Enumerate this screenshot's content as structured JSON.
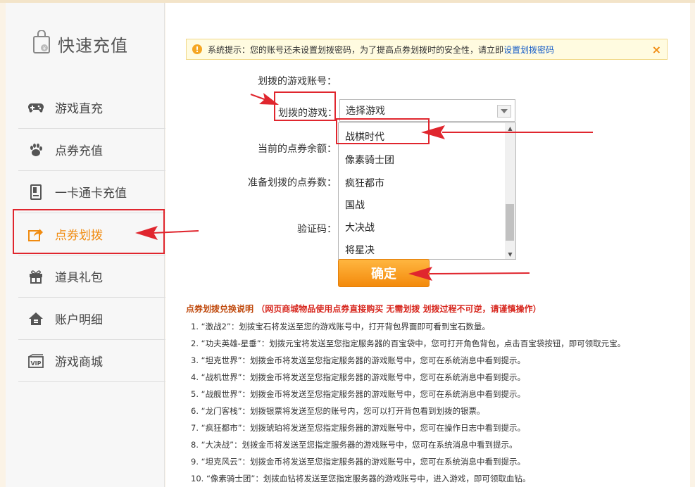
{
  "sidebar": {
    "title": "快速充值",
    "items": [
      {
        "label": "游戏直充",
        "icon": "gamepad-icon"
      },
      {
        "label": "点券充值",
        "icon": "paw-icon"
      },
      {
        "label": "一卡通卡充值",
        "icon": "card-icon"
      },
      {
        "label": "点券划拨",
        "icon": "share-icon",
        "active": true
      },
      {
        "label": "道具礼包",
        "icon": "gift-icon"
      },
      {
        "label": "账户明细",
        "icon": "home-icon"
      },
      {
        "label": "游戏商城",
        "icon": "vip-icon"
      }
    ]
  },
  "notice": {
    "text": "系统提示：您的账号还未设置划拨密码，为了提高点券划拨时的安全性，请立即",
    "link": "设置划拨密码",
    "close": "×"
  },
  "form": {
    "account_label": "划拨的游戏账号：",
    "game_label": "划拨的游戏：",
    "balance_label": "当前的点券余额：",
    "amount_label": "准备划拨的点券数：",
    "captcha_label": "验证码：",
    "select_value": "选择游戏",
    "options": [
      "战棋时代",
      "像素骑士团",
      "疯狂都市",
      "国战",
      "大决战",
      "将星决"
    ],
    "confirm_label": "确定"
  },
  "explain": {
    "title": "点券划拨兑换说明",
    "note": "（网页商城物品使用点券直接购买 无需划拨 划拨过程不可逆，请谨慎操作）",
    "rules": [
      "1. “激战2”：划拨宝石将发送至您的游戏账号中，打开背包界面即可看到宝石数量。",
      "2. “功夫英雄-星垂”：划拨元宝将发送至您指定服务器的百宝袋中，您可打开角色背包，点击百宝袋按钮，即可领取元宝。",
      "3. “坦克世界”：划拨金币将发送至您指定服务器的游戏账号中，您可在系统消息中看到提示。",
      "4. “战机世界”：划拨金币将发送至您指定服务器的游戏账号中，您可在系统消息中看到提示。",
      "5. “战舰世界”：划拨金币将发送至您指定服务器的游戏账号中，您可在系统消息中看到提示。",
      "6. “龙门客栈”：划拨银票将发送至您的账号内，您可以打开背包看到划拨的银票。",
      "7. “疯狂都市”：划拨琥珀将发送至您指定服务器的游戏账号中，您可在操作日志中看到提示。",
      "8. “大决战”：划拨金币将发送至您指定服务器的游戏账号中，您可在系统消息中看到提示。",
      "9. “坦克风云”：划拨金币将发送至您指定服务器的游戏账号中，您可在系统消息中看到提示。",
      "10. “像素骑士团”：划拨血钻将发送至您指定服务器的游戏账号中，进入游戏，即可领取血钻。"
    ]
  },
  "colors": {
    "accent": "#f08b10",
    "annotation": "#e0262e",
    "link": "#1a5fc7"
  }
}
